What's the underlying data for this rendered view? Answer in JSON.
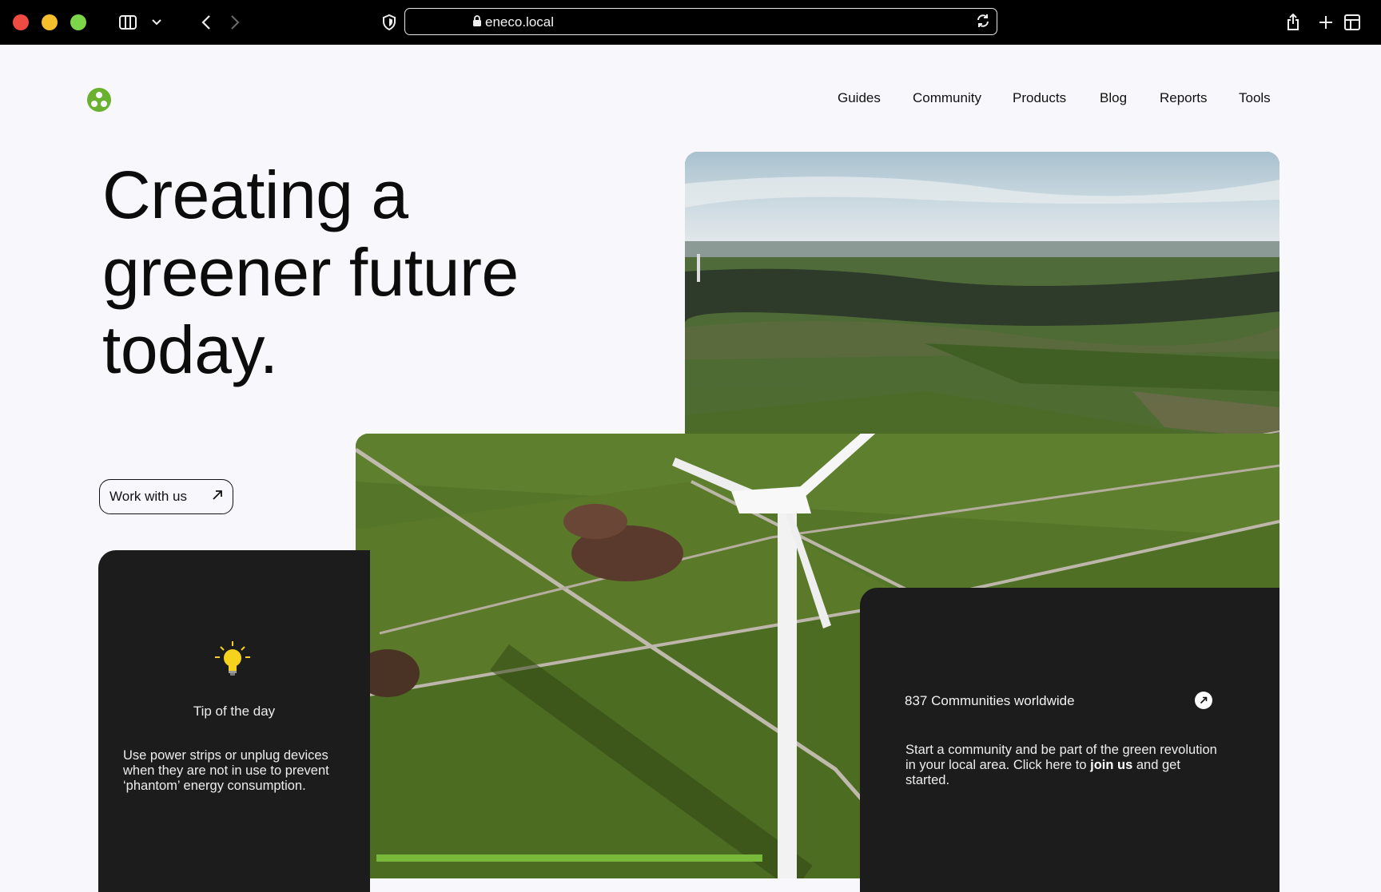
{
  "browser": {
    "url": "eneco.local",
    "icons": [
      "sidebar-icon",
      "chevron-down-icon",
      "back-icon",
      "forward-icon",
      "shield-icon",
      "lock-icon",
      "reload-icon",
      "share-icon",
      "new-tab-icon",
      "tab-overview-icon"
    ]
  },
  "nav": {
    "items": [
      "Guides",
      "Community",
      "Products",
      "Blog",
      "Reports",
      "Tools"
    ]
  },
  "hero": {
    "headline_lines": [
      "Creating a",
      "greener future",
      "today."
    ],
    "cta_label": "Work with us",
    "cta_icon": "arrow-up-right-icon"
  },
  "tip": {
    "icon": "lightbulb-icon",
    "title": "Tip of the day",
    "body": "Use power strips or unplug devices when they are not in use to prevent ‘phantom’ energy consumption."
  },
  "community": {
    "title": "837 Communities worldwide",
    "body_before": "Start a community and be part of the green revolution in your local area. Click here to ",
    "body_link": "join us",
    "body_after": " and get started."
  },
  "colors": {
    "brand_green": "#6bb130",
    "progress_green": "#78b83a",
    "card_dark": "#1c1c1c",
    "page_bg": "#f8f8fc",
    "bulb_yellow": "#f7d21d"
  },
  "image": {
    "progress_fraction": 0.42
  }
}
